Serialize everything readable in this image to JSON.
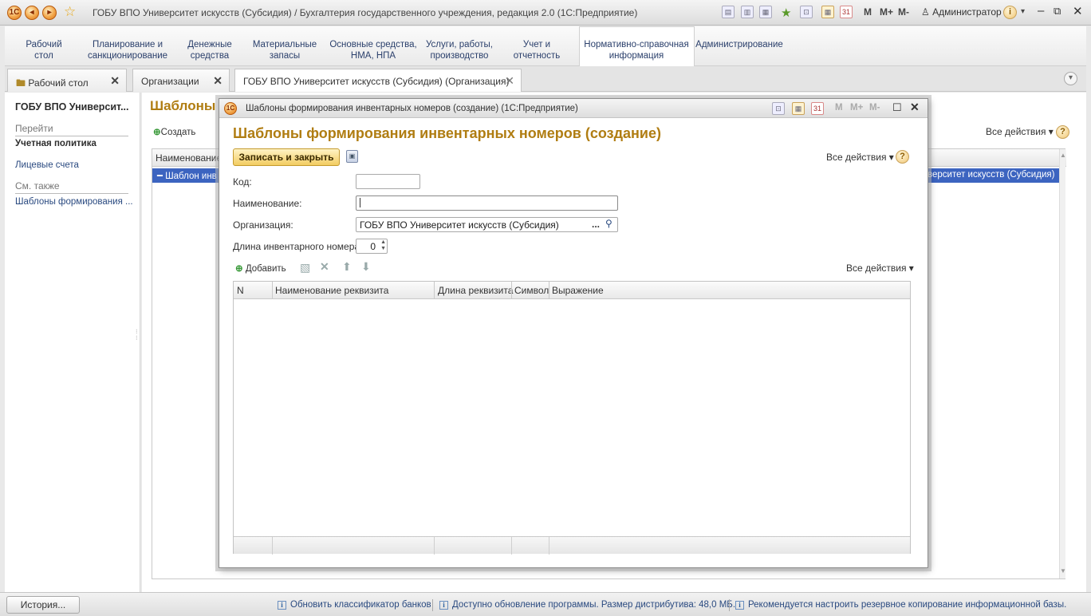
{
  "window": {
    "title": "ГОБУ ВПО Университет искусств (Субсидия) / Бухгалтерия государственного учреждения, редакция 2.0  (1С:Предприятие)",
    "memory_buttons": [
      "M",
      "M+",
      "M-"
    ],
    "user": "Администратор"
  },
  "sections": [
    {
      "label": "Рабочий\nстол"
    },
    {
      "label": "Планирование и\nсанкционирование"
    },
    {
      "label": "Денежные\nсредства"
    },
    {
      "label": "Материальные\nзапасы"
    },
    {
      "label": "Основные средства,\nНМА, НПА"
    },
    {
      "label": "Услуги, работы,\nпроизводство"
    },
    {
      "label": "Учет и\nотчетность"
    },
    {
      "label": "Нормативно-справочная\nинформация"
    },
    {
      "label": "Администрирование"
    }
  ],
  "tabs": [
    {
      "label": "Рабочий стол"
    },
    {
      "label": "Организации"
    },
    {
      "label": "ГОБУ ВПО Университет искусств (Субсидия) (Организация)"
    }
  ],
  "left_panel": {
    "title": "ГОБУ ВПО Университ...",
    "goto_header": "Перейти",
    "goto_items": [
      "Учетная политика",
      "Лицевые счета"
    ],
    "see_also_header": "См. также",
    "see_also_items": [
      "Шаблоны формирования ..."
    ]
  },
  "main": {
    "title": "Шаблоны",
    "create_label": "Создать",
    "all_actions": "Все действия",
    "column_name": "Наименование",
    "row_text": "Шаблон инв",
    "row_text_right": "верситет искусств (Субсидия)"
  },
  "dialog": {
    "window_title": "Шаблоны формирования инвентарных номеров (создание)  (1С:Предприятие)",
    "heading": "Шаблоны формирования инвентарных номеров (создание)",
    "save_close": "Записать и закрыть",
    "all_actions": "Все действия",
    "memory_buttons": [
      "M",
      "M+",
      "M-"
    ],
    "fields": {
      "code_label": "Код:",
      "code_value": "",
      "name_label": "Наименование:",
      "name_value": "",
      "org_label": "Организация:",
      "org_value": "ГОБУ ВПО Университет искусств (Субсидия)",
      "length_label": "Длина инвентарного номера:",
      "length_value": "0"
    },
    "table_toolbar": {
      "add_label": "Добавить",
      "all_actions": "Все действия"
    },
    "table_columns": [
      "N",
      "Наименование реквизита",
      "Длина реквизита",
      "Символ",
      "Выражение"
    ]
  },
  "status_bar": {
    "history": "История...",
    "messages": [
      "Обновить классификатор банков",
      "Доступно обновление программы. Размер дистрибутива: 48,0 МБ.",
      "Рекомендуется настроить резервное копирование информационной базы."
    ]
  },
  "colors": {
    "accent_title": "#b07d12",
    "selection": "#3c64c0",
    "link": "#2a4a80"
  }
}
